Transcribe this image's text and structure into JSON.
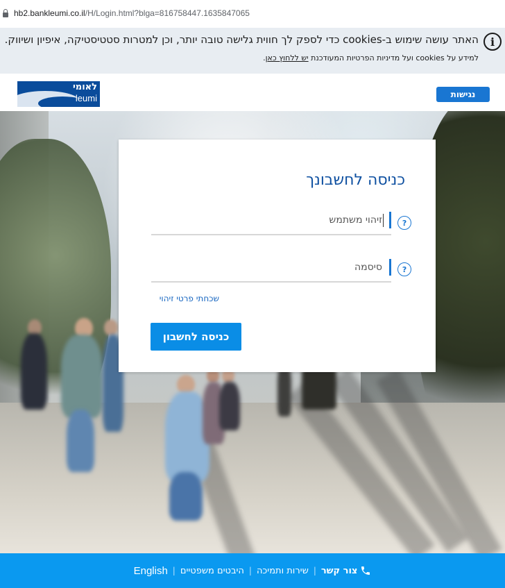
{
  "browser": {
    "url_host": "hb2.bankleumi.co.il",
    "url_path": "/H/Login.html?blga=816758447.1635847065"
  },
  "cookie_banner": {
    "message": "האתר עושה שימוש ב-cookies כדי לספק לך חווית גלישה טובה יותר, וכן למטרות סטטיסטיקה, איפיון ושיווק.",
    "details_prefix": "למידע על cookies ועל מדיניות הפרטיות המעודכנת",
    "details_link": "יש ללחוץ כאן",
    "details_suffix": "."
  },
  "header": {
    "logo_he": "לאומי",
    "logo_en": "leumi",
    "accessibility_label": "נגישות"
  },
  "login": {
    "title": "כניסה לחשבונך",
    "username_placeholder": "זיהוי משתמש",
    "password_placeholder": "סיסמה",
    "help_symbol": "?",
    "forgot_link": "שכחתי פרטי זיהוי",
    "submit_label": "כניסה לחשבון"
  },
  "footer": {
    "contact": "צור קשר",
    "service": "שירות ותמיכה",
    "legal": "היבטים משפטיים",
    "english": "English",
    "separator": "|"
  }
}
